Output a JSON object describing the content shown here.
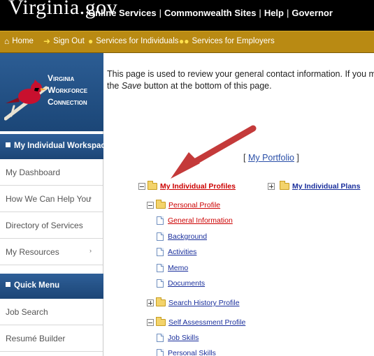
{
  "top_bar": {
    "brand": "Virginia.gov",
    "links": [
      "Online Services",
      "Commonwealth Sites",
      "Help",
      "Governor"
    ]
  },
  "nav_bar": {
    "items": [
      {
        "label": "Home",
        "icon": "home-icon"
      },
      {
        "label": "Sign Out",
        "icon": "sign-out-arrow-icon"
      },
      {
        "label": "Services for Individuals",
        "icon": "person-icon"
      },
      {
        "label": "Services for Employers",
        "icon": "people-icon"
      }
    ]
  },
  "logo": {
    "lines": [
      "Virginia",
      "Workforce",
      "Connection"
    ],
    "icon": "cardinal-bird-logo"
  },
  "sidebar": {
    "section1_title": "My Individual Workspace",
    "section1_items": [
      {
        "label": "My Dashboard"
      },
      {
        "label": "How We Can Help You",
        "chevron": "›"
      },
      {
        "label": "Directory of Services"
      },
      {
        "label": "My Resources",
        "chevron": "›"
      }
    ],
    "section2_title": "Quick Menu",
    "section2_items": [
      {
        "label": "Job Search"
      },
      {
        "label": "Resumé Builder"
      }
    ]
  },
  "main": {
    "intro_line1": "This page is used to review your general contact information. If you make cha",
    "intro_line2_before": "the ",
    "intro_line2_em": "Save",
    "intro_line2_after": " button at the bottom of this page.",
    "portfolio_open": "[ ",
    "portfolio_link": "My Portfolio",
    "portfolio_close": " ]",
    "tree": {
      "profiles": "My Individual Profiles",
      "plans": "My Individual Plans",
      "personal_profile": "Personal Profile",
      "general_information": "General Information",
      "background": "Background",
      "activities": "Activities",
      "memo": "Memo",
      "documents": "Documents",
      "search_history_profile": "Search History Profile",
      "self_assessment_profile": "Self Assessment Profile",
      "job_skills": "Job Skills",
      "personal_skills": "Personal Skills"
    }
  },
  "colors": {
    "top_bar": "#000000",
    "nav_bar": "#b98a13",
    "sidebar_header": "#1c4576",
    "link_red": "#cc0000",
    "link_blue": "#1a2f9c",
    "annotation_arrow": "#c43a3a"
  }
}
